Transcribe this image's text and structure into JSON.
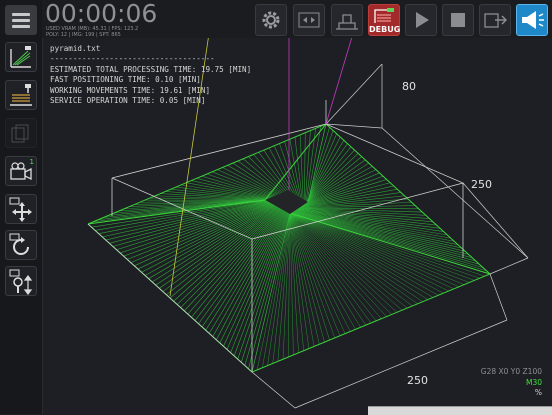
{
  "timer": "00:00:06",
  "stats": {
    "line1": "USED VRAM (MB): 45.31 | FPS: 123.2",
    "line2": "POLY: 12 | IMG: 199 | SPT: 865"
  },
  "toolbar": {
    "debug_label": "DEBUG"
  },
  "info": {
    "filename": "pyramid.txt",
    "separator": "------------------------------------",
    "estimated": "ESTIMATED TOTAL PROCESSING TIME: 19.75 [MIN]",
    "fast": "FAST POSITIONING TIME: 0.10 [MIN]",
    "working": "WORKING MOVEMENTS TIME: 19.61 [MIN]",
    "service": "SERVICE OPERATION TIME: 0.05 [MIN]"
  },
  "dimensions": {
    "height": "80",
    "depth": "250",
    "width": "250"
  },
  "gcode": {
    "line1": "G28 X0 Y0 Z100",
    "line2": "M30",
    "line3": "%"
  },
  "sidebar_badges": {
    "camera": "1"
  },
  "colors": {
    "toolpath": "#2fc43a",
    "bounding_box": "#d8d8d8",
    "debug": "#a32a2a",
    "active": "#1e88c8",
    "gcode_active": "#3ce13c"
  }
}
